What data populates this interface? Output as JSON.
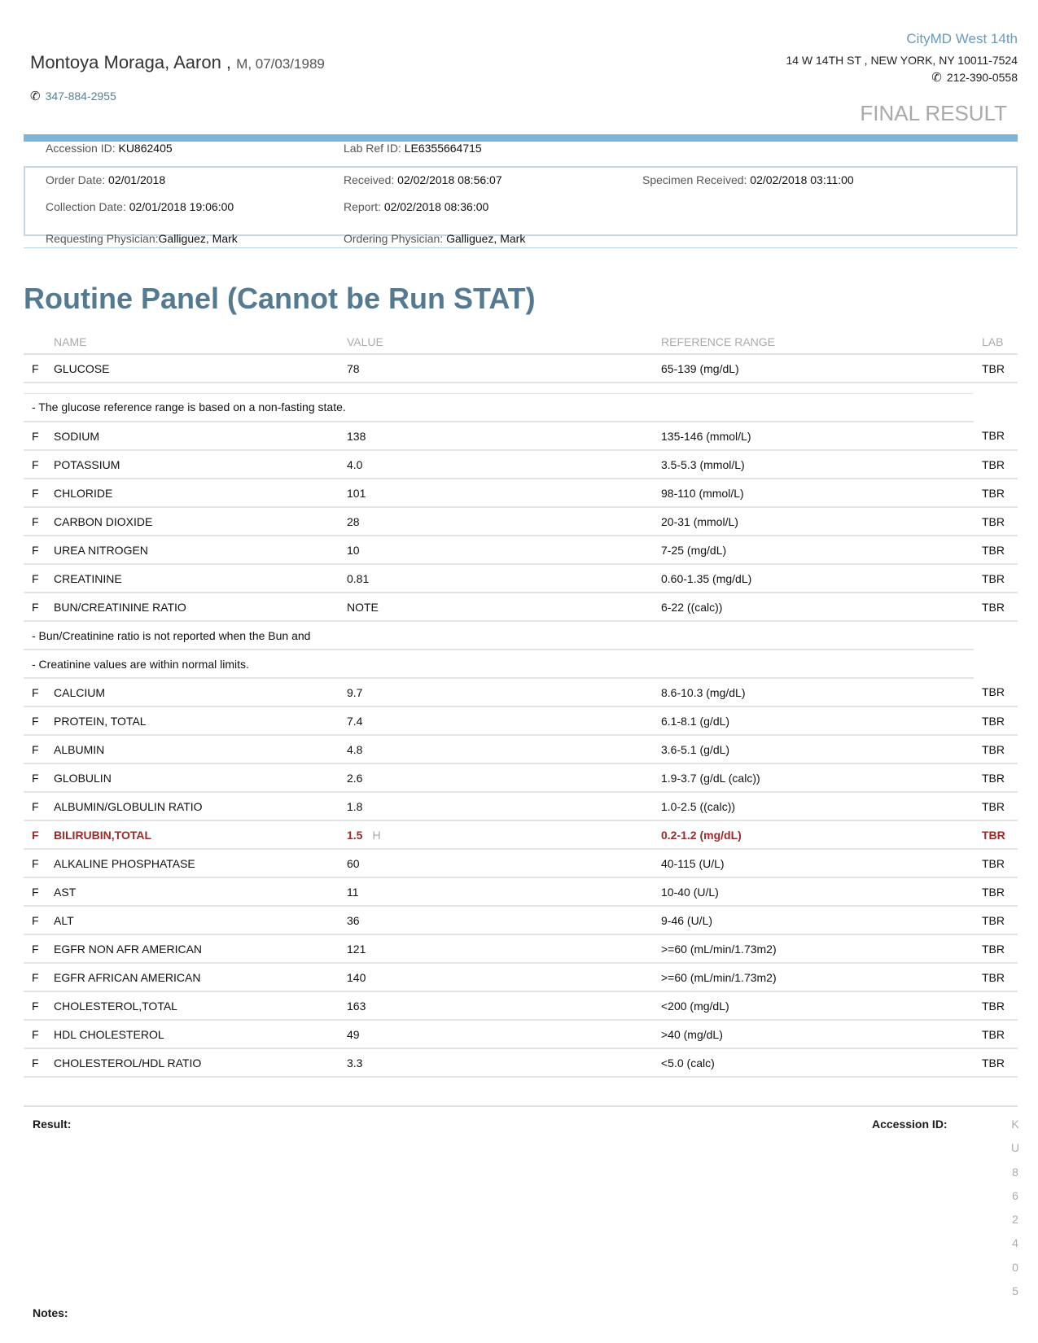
{
  "patient": {
    "name": "Montoya Moraga, Aaron ,",
    "demographics": "M, 07/03/1989",
    "phone": "347-884-2955"
  },
  "clinic": {
    "name": "CityMD West 14th",
    "address": "14 W 14TH ST , NEW YORK, NY 10011-7524",
    "phone": "212-390-0558"
  },
  "status": "FINAL RESULT",
  "meta": {
    "accession_label": "Accession ID:",
    "accession_value": "KU862405",
    "lab_ref_label": "Lab Ref ID:",
    "lab_ref_value": "LE6355664715",
    "order_date_label": "Order Date:",
    "order_date_value": "02/01/2018",
    "received_label": "Received:",
    "received_value": "02/02/2018 08:56:07",
    "specimen_received_label": "Specimen Received:",
    "specimen_received_value": "02/02/2018  03:11:00",
    "collection_date_label": "Collection Date:",
    "collection_date_value": "02/01/2018 19:06:00",
    "report_label": "Report:",
    "report_value": "02/02/2018  08:36:00",
    "requesting_label": "Requesting Physician:",
    "requesting_value": "Galliguez, Mark",
    "ordering_label": "Ordering Physician:",
    "ordering_value": "Galliguez, Mark"
  },
  "panel": {
    "title": "Routine Panel (Cannot be Run STAT)",
    "headers": {
      "name": "NAME",
      "value": "VALUE",
      "reference": "REFERENCE RANGE",
      "lab": "LAB"
    },
    "rows": [
      {
        "flag": "F",
        "name": "GLUCOSE",
        "value": "78",
        "reference": "65-139 (mg/dL)",
        "lab": "TBR"
      },
      {
        "flag": "F",
        "name": "SODIUM",
        "value": "138",
        "reference": "135-146 (mmol/L)",
        "lab": "TBR"
      },
      {
        "flag": "F",
        "name": "POTASSIUM",
        "value": "4.0",
        "reference": "3.5-5.3 (mmol/L)",
        "lab": "TBR"
      },
      {
        "flag": "F",
        "name": "CHLORIDE",
        "value": "101",
        "reference": "98-110 (mmol/L)",
        "lab": "TBR"
      },
      {
        "flag": "F",
        "name": "CARBON DIOXIDE",
        "value": "28",
        "reference": "20-31 (mmol/L)",
        "lab": "TBR"
      },
      {
        "flag": "F",
        "name": "UREA NITROGEN",
        "value": "10",
        "reference": "7-25 (mg/dL)",
        "lab": "TBR"
      },
      {
        "flag": "F",
        "name": "CREATININE",
        "value": "0.81",
        "reference": "0.60-1.35 (mg/dL)",
        "lab": "TBR"
      },
      {
        "flag": "F",
        "name": "BUN/CREATININE RATIO",
        "value": "NOTE",
        "reference": "6-22 ((calc))",
        "lab": "TBR"
      },
      {
        "flag": "F",
        "name": "CALCIUM",
        "value": "9.7",
        "reference": "8.6-10.3 (mg/dL)",
        "lab": "TBR"
      },
      {
        "flag": "F",
        "name": "PROTEIN, TOTAL",
        "value": "7.4",
        "reference": "6.1-8.1 (g/dL)",
        "lab": "TBR"
      },
      {
        "flag": "F",
        "name": "ALBUMIN",
        "value": "4.8",
        "reference": "3.6-5.1 (g/dL)",
        "lab": "TBR"
      },
      {
        "flag": "F",
        "name": "GLOBULIN",
        "value": "2.6",
        "reference": "1.9-3.7 (g/dL (calc))",
        "lab": "TBR"
      },
      {
        "flag": "F",
        "name": "ALBUMIN/GLOBULIN RATIO",
        "value": "1.8",
        "reference": "1.0-2.5 ((calc))",
        "lab": "TBR"
      },
      {
        "flag": "F",
        "name": "BILIRUBIN,TOTAL",
        "value": "1.5",
        "abnormal_flag": "H",
        "reference": "0.2-1.2 (mg/dL)",
        "lab": "TBR"
      },
      {
        "flag": "F",
        "name": "ALKALINE PHOSPHATASE",
        "value": "60",
        "reference": "40-115 (U/L)",
        "lab": "TBR"
      },
      {
        "flag": "F",
        "name": "AST",
        "value": "11",
        "reference": "10-40 (U/L)",
        "lab": "TBR"
      },
      {
        "flag": "F",
        "name": "ALT",
        "value": "36",
        "reference": "9-46 (U/L)",
        "lab": "TBR"
      },
      {
        "flag": "F",
        "name": "EGFR NON AFR AMERICAN",
        "value": "121",
        "reference": ">=60 (mL/min/1.73m2)",
        "lab": "TBR"
      },
      {
        "flag": "F",
        "name": "EGFR AFRICAN AMERICAN",
        "value": "140",
        "reference": ">=60 (mL/min/1.73m2)",
        "lab": "TBR"
      },
      {
        "flag": "F",
        "name": "CHOLESTEROL,TOTAL",
        "value": "163",
        "reference": "<200 (mg/dL)",
        "lab": "TBR"
      },
      {
        "flag": "F",
        "name": "HDL CHOLESTEROL",
        "value": "49",
        "reference": ">40 (mg/dL)",
        "lab": "TBR"
      },
      {
        "flag": "F",
        "name": "CHOLESTEROL/HDL RATIO",
        "value": "3.3",
        "reference": "<5.0 (calc)",
        "lab": "TBR"
      }
    ],
    "notes": {
      "glucose": "- The glucose reference range is based on a non-fasting state.",
      "bun_1": "- Bun/Creatinine ratio is not reported when the Bun and",
      "bun_2": "- Creatinine values are within normal limits."
    }
  },
  "footer": {
    "result_label": "Result:",
    "accession_label": "Accession ID:",
    "accession_chars": [
      "K",
      "U",
      "8",
      "6",
      "2",
      "4",
      "0",
      "5"
    ],
    "notes_label": "Notes:"
  },
  "colors": {
    "accent_bar": "#7db5d8",
    "title": "#537a90",
    "abnormal": "#9c2a2a"
  }
}
